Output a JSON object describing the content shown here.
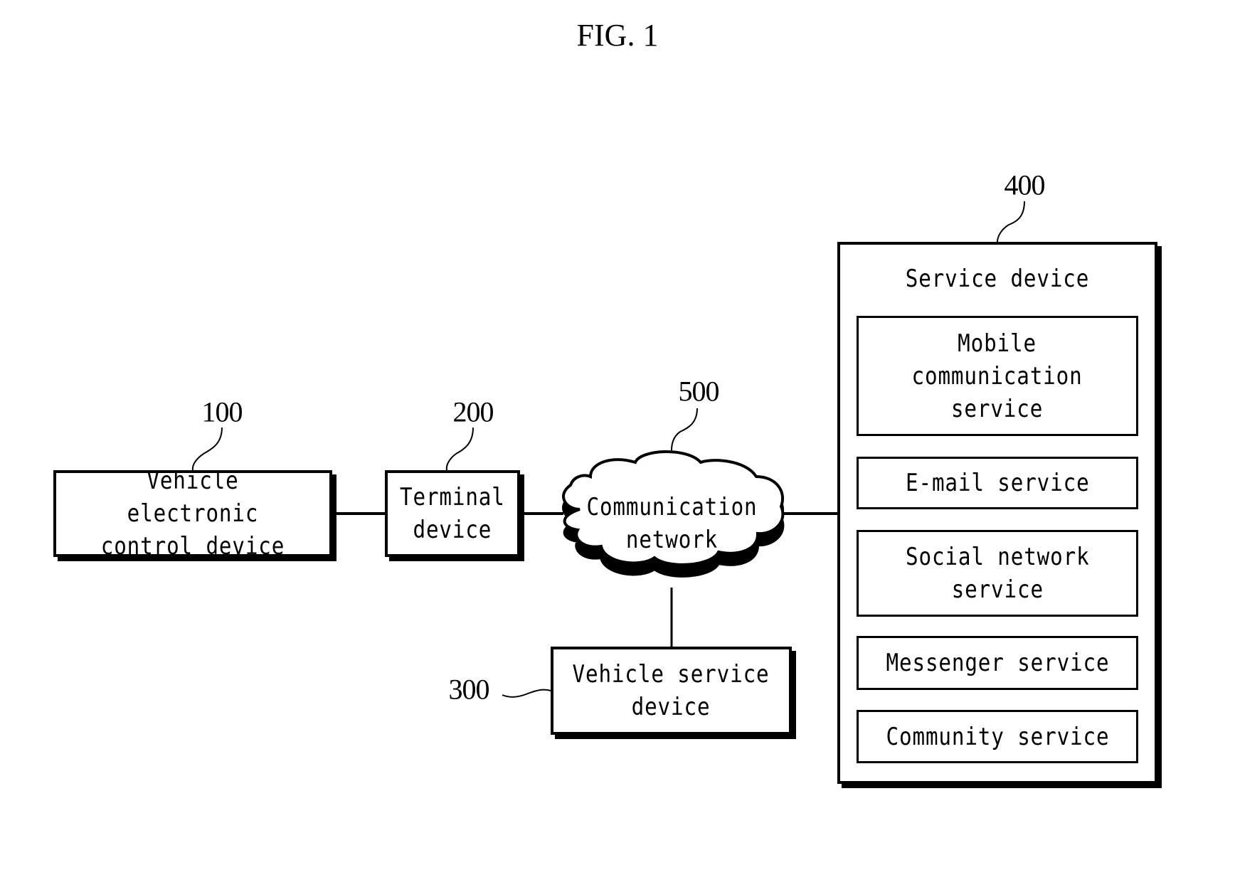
{
  "figure": {
    "title": "FIG. 1"
  },
  "nodes": {
    "vehicle_ecu": {
      "ref": "100",
      "label": "Vehicle electronic\ncontrol device"
    },
    "terminal": {
      "ref": "200",
      "label": "Terminal\ndevice"
    },
    "vehicle_service": {
      "ref": "300",
      "label": "Vehicle service\ndevice"
    },
    "service_device": {
      "ref": "400",
      "label": "Service device",
      "services": [
        {
          "label": "Mobile\ncommunication\nservice"
        },
        {
          "label": "E-mail service"
        },
        {
          "label": "Social network\nservice"
        },
        {
          "label": "Messenger service"
        },
        {
          "label": "Community service"
        }
      ]
    },
    "network": {
      "ref": "500",
      "label": "Communication\nnetwork"
    }
  },
  "connections": [
    {
      "from": "Vehicle electronic control device",
      "to": "Terminal device"
    },
    {
      "from": "Terminal device",
      "to": "Communication network"
    },
    {
      "from": "Communication network",
      "to": "Service device"
    },
    {
      "from": "Communication network",
      "to": "Vehicle service device"
    }
  ]
}
